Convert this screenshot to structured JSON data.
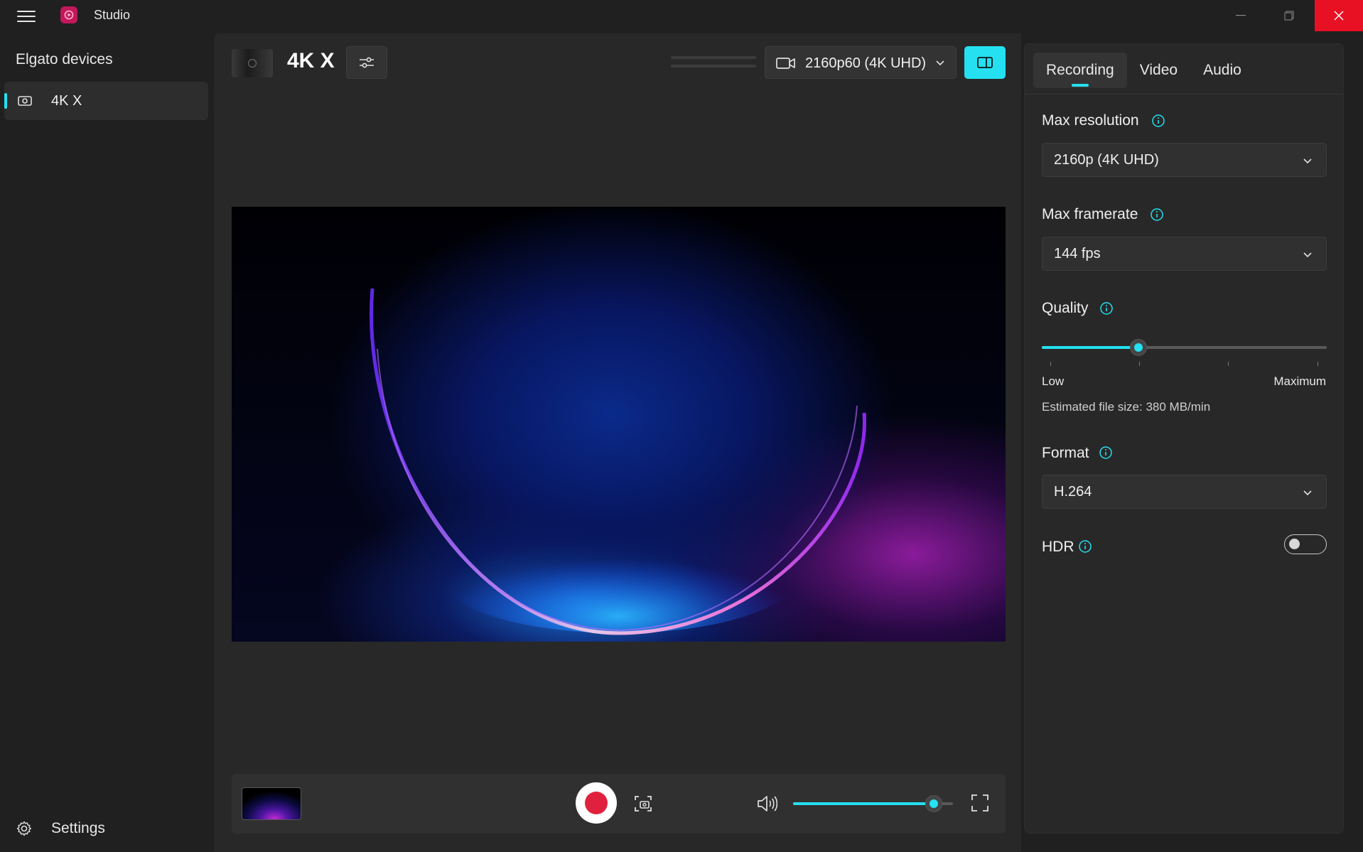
{
  "app": {
    "title": "Studio"
  },
  "sidebar": {
    "heading": "Elgato devices",
    "devices": [
      {
        "label": "4K X",
        "selected": true
      }
    ],
    "settings_label": "Settings"
  },
  "main": {
    "device_name": "4K X",
    "resolution_select": {
      "value": "2160p60 (4K UHD)"
    }
  },
  "controls": {
    "volume_level_percent": 88
  },
  "panel": {
    "tabs": [
      {
        "label": "Recording",
        "active": true
      },
      {
        "label": "Video",
        "active": false
      },
      {
        "label": "Audio",
        "active": false
      }
    ],
    "max_resolution": {
      "label": "Max resolution",
      "value": "2160p (4K UHD)"
    },
    "max_framerate": {
      "label": "Max framerate",
      "value": "144 fps"
    },
    "quality": {
      "label": "Quality",
      "level_percent": 34,
      "min_label": "Low",
      "max_label": "Maximum",
      "estimate": "Estimated file size: 380 MB/min"
    },
    "format": {
      "label": "Format",
      "value": "H.264"
    },
    "hdr": {
      "label": "HDR",
      "enabled": false
    }
  },
  "colors": {
    "accent": "#24e0f0",
    "record": "#e0213d",
    "close": "#e81123",
    "background": "#202020",
    "surface": "#282828"
  }
}
